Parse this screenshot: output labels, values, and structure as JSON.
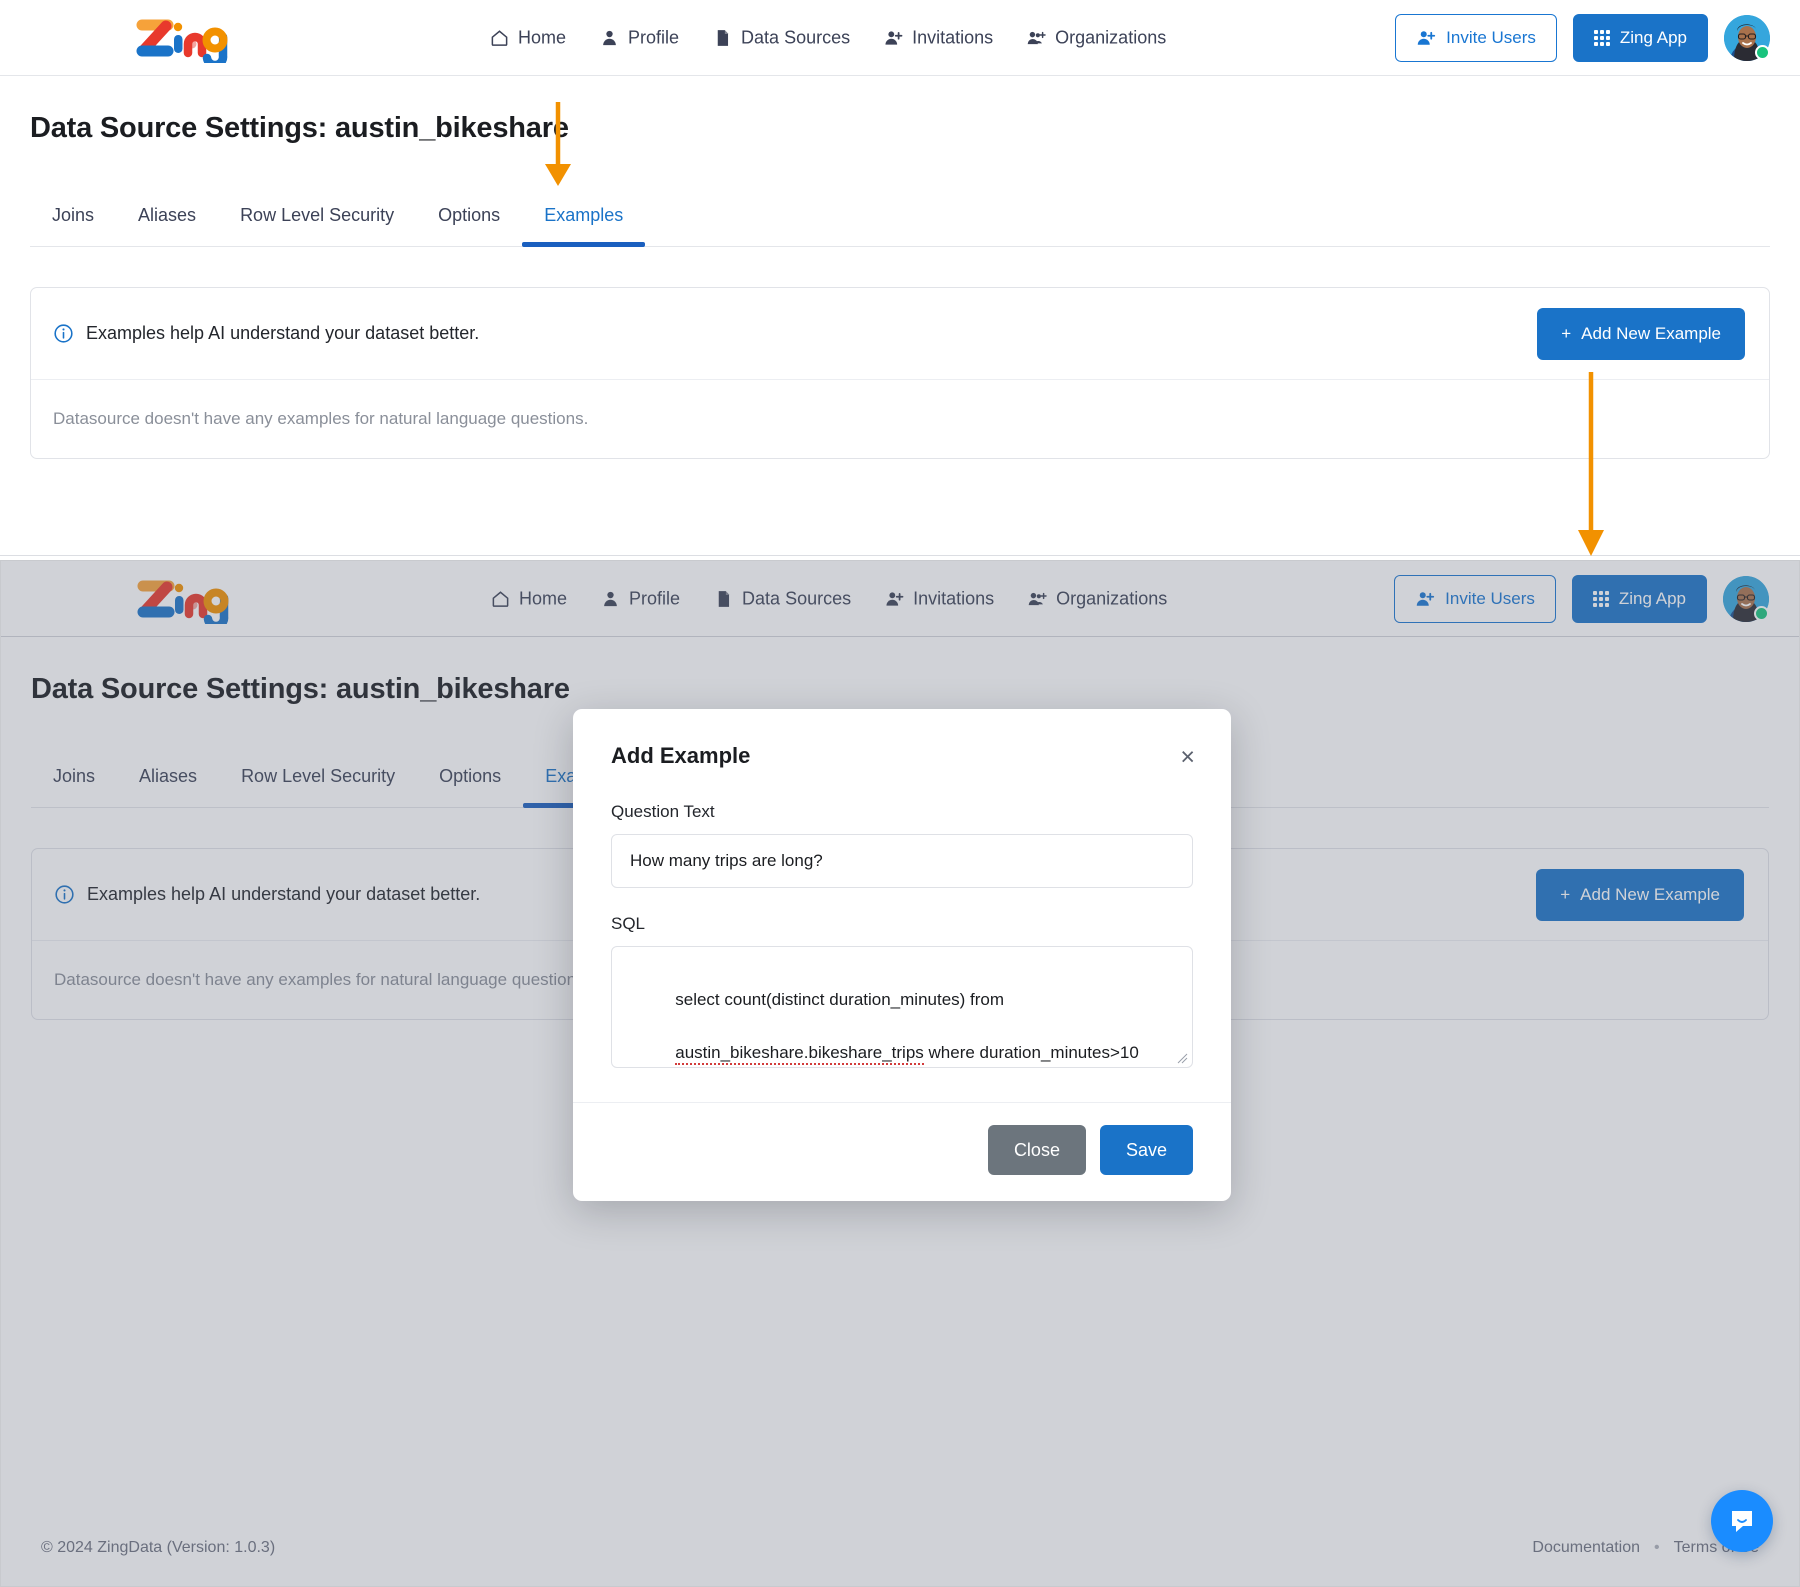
{
  "brand": {
    "logo_text": "Zing",
    "accent_blue": "#1a73c8",
    "accent_orange": "#f29100"
  },
  "nav": {
    "items": [
      {
        "label": "Home",
        "icon": "home-icon"
      },
      {
        "label": "Profile",
        "icon": "person-icon"
      },
      {
        "label": "Data Sources",
        "icon": "document-icon"
      },
      {
        "label": "Invitations",
        "icon": "person-add-icon"
      },
      {
        "label": "Organizations",
        "icon": "people-add-icon"
      }
    ],
    "invite_users_label": "Invite Users",
    "zing_app_label": "Zing App"
  },
  "page": {
    "title": "Data Source Settings: austin_bikeshare",
    "tabs": [
      {
        "label": "Joins",
        "active": false
      },
      {
        "label": "Aliases",
        "active": false
      },
      {
        "label": "Row Level Security",
        "active": false
      },
      {
        "label": "Options",
        "active": false
      },
      {
        "label": "Examples",
        "active": true
      }
    ]
  },
  "examples_card": {
    "hint": "Examples help AI understand your dataset better.",
    "add_button_label": "Add New Example",
    "add_button_plus": "+",
    "empty_message": "Datasource doesn't have any examples for natural language questions."
  },
  "modal": {
    "title": "Add Example",
    "close_icon": "×",
    "question_label": "Question Text",
    "question_value": "How many trips are long?",
    "question_placeholder": "",
    "sql_label": "SQL",
    "sql_line_1": "select count(distinct duration_minutes) from",
    "sql_line_2a": "austin_bikeshare.bikeshare_trips",
    "sql_line_2b": " where duration_minutes>10",
    "close_label": "Close",
    "save_label": "Save"
  },
  "footer": {
    "copyright": "© 2024 ZingData (Version: 1.0.3)",
    "documentation": "Documentation",
    "separator": "•",
    "terms": "Terms of Se"
  }
}
